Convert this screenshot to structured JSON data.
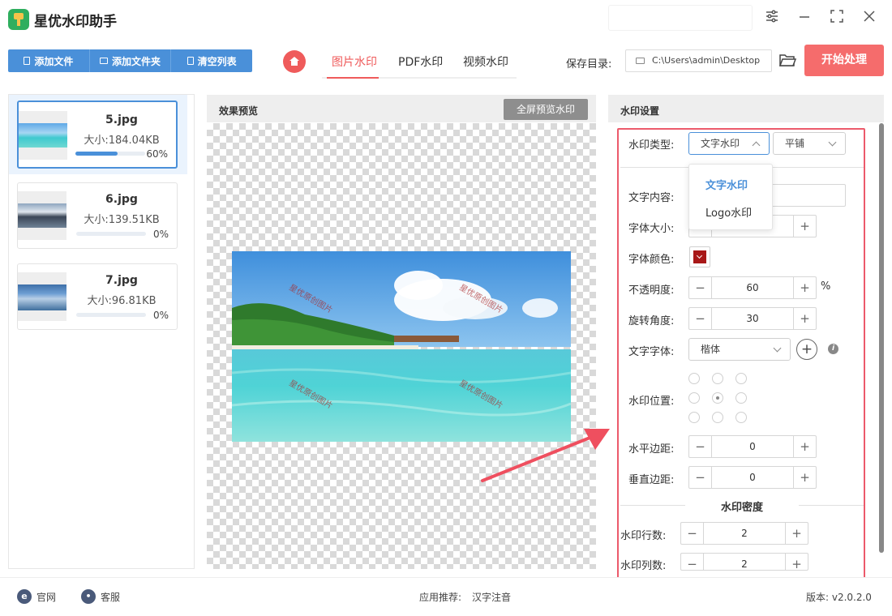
{
  "app": {
    "title": "星优水印助手"
  },
  "toolbar": {
    "add_file": "添加文件",
    "add_folder": "添加文件夹",
    "clear_list": "清空列表",
    "tabs": [
      "图片水印",
      "PDF水印",
      "视频水印"
    ],
    "active_tab": "图片水印",
    "save_label": "保存目录:",
    "save_path": "C:\\Users\\admin\\Desktop",
    "start": "开始处理"
  },
  "files": [
    {
      "name": "5.jpg",
      "size": "大小:184.04KB",
      "progress_text": "60%",
      "progress": 0.6
    },
    {
      "name": "6.jpg",
      "size": "大小:139.51KB",
      "progress_text": "0%",
      "progress": 0
    },
    {
      "name": "7.jpg",
      "size": "大小:96.81KB",
      "progress_text": "0%",
      "progress": 0
    }
  ],
  "preview": {
    "title": "效果预览",
    "fullscreen": "全屏预览水印",
    "watermark_text": "星优原创图片"
  },
  "settings": {
    "title": "水印设置",
    "type_label": "水印类型:",
    "type_value": "文字水印",
    "layout_value": "平铺",
    "dropdown": [
      "文字水印",
      "Logo水印"
    ],
    "text_label": "文字内容:",
    "size_label": "字体大小:",
    "color_label": "字体颜色:",
    "font_color": "#a81818",
    "opacity_label": "不透明度:",
    "opacity_value": "60",
    "opacity_unit": "%",
    "rotation_label": "旋转角度:",
    "rotation_value": "30",
    "font_label": "文字字体:",
    "font_value": "楷体",
    "position_label": "水印位置:",
    "hmargin_label": "水平边距:",
    "hmargin_value": "0",
    "vmargin_label": "垂直边距:",
    "vmargin_value": "0",
    "density_title": "水印密度",
    "rows_label": "水印行数:",
    "rows_value": "2",
    "cols_label": "水印列数:",
    "cols_value": "2"
  },
  "footer": {
    "website": "官网",
    "service": "客服",
    "recommend_label": "应用推荐:",
    "recommend_app": "汉字注音",
    "version": "版本: v2.0.2.0"
  },
  "colors": {
    "accent": "#4a90d9",
    "danger": "#f56c6c",
    "highlight_frame": "#ec5a6b"
  }
}
